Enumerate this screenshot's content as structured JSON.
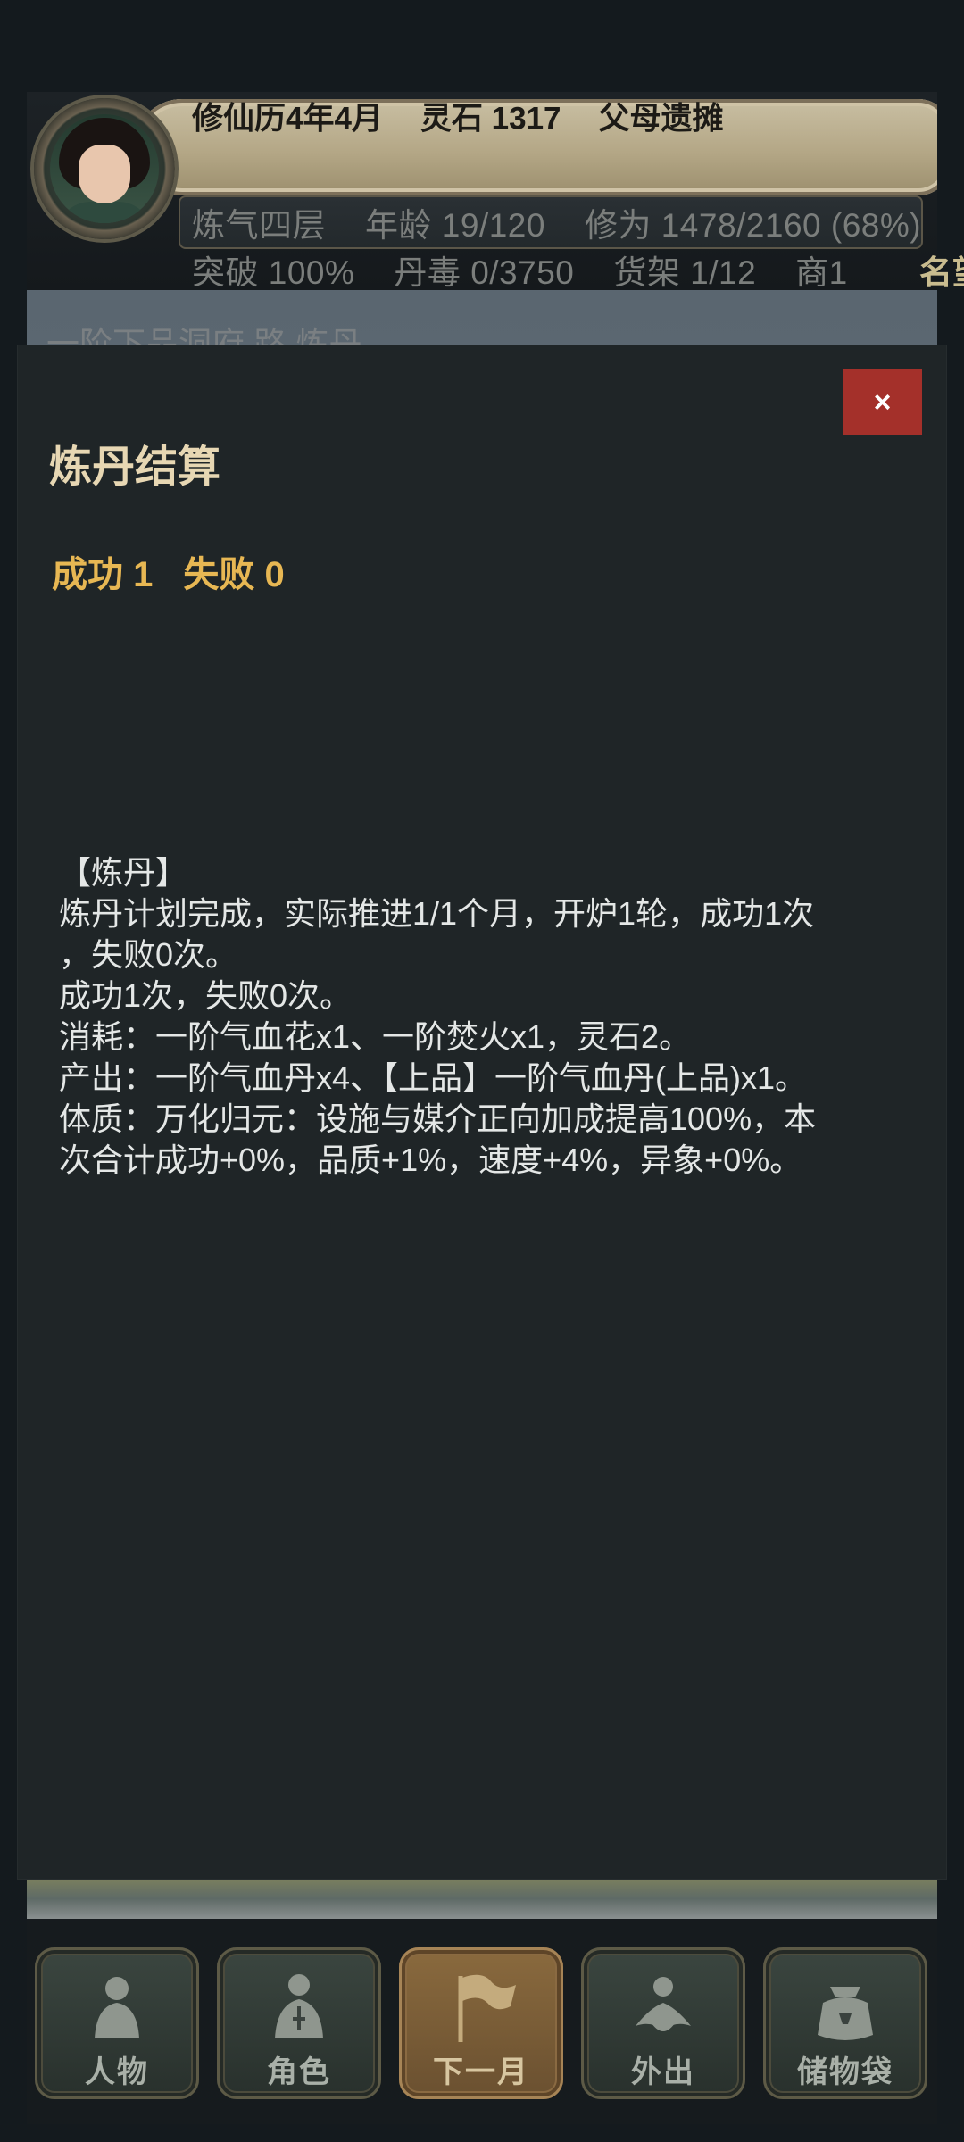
{
  "header": {
    "calendar": "修仙历4年4月",
    "spirit_stone": "灵石 1317",
    "origin": "父母遗摊",
    "realm": "炼气四层",
    "age": "年龄 19/120",
    "cultivation": "修为 1478/2160 (68%)",
    "breakthrough": "突破 100%",
    "pill_toxicity": "丹毒 0/3750",
    "shelf": "货架 1/12",
    "merchant": "商1",
    "fame_cutoff": "名望"
  },
  "scene": {
    "title": "一阶下品洞府 路 炼丹"
  },
  "modal": {
    "close_label": "×",
    "title": "炼丹结算",
    "success": "成功 1",
    "failure": "失败 0",
    "log_lines": [
      "【炼丹】",
      "炼丹计划完成，实际推进1/1个月，开炉1轮，成功1次",
      "，失败0次。",
      "成功1次，失败0次。",
      "消耗：一阶气血花x1、一阶焚火x1，灵石2。",
      "产出：一阶气血丹x4、【上品】一阶气血丹(上品)x1。",
      "体质：万化归元：设施与媒介正向加成提高100%，本",
      "次合计成功+0%，品质+1%，速度+4%，异象+0%。"
    ]
  },
  "bottom_nav": {
    "items": [
      {
        "label": "人物",
        "icon": "person-icon"
      },
      {
        "label": "角色",
        "icon": "robed-figure-icon"
      },
      {
        "label": "下一月",
        "icon": "flag-icon"
      },
      {
        "label": "外出",
        "icon": "traveler-icon"
      },
      {
        "label": "储物袋",
        "icon": "storage-bag-icon"
      }
    ],
    "active_index": 2
  },
  "colors": {
    "modal_bg": "#1f2527",
    "close_button": "#a4302a",
    "title_text": "#e7d7b3",
    "stats_text": "#e7b753",
    "log_text": "#e4e7e6",
    "active_nav": "#7a5d36"
  }
}
